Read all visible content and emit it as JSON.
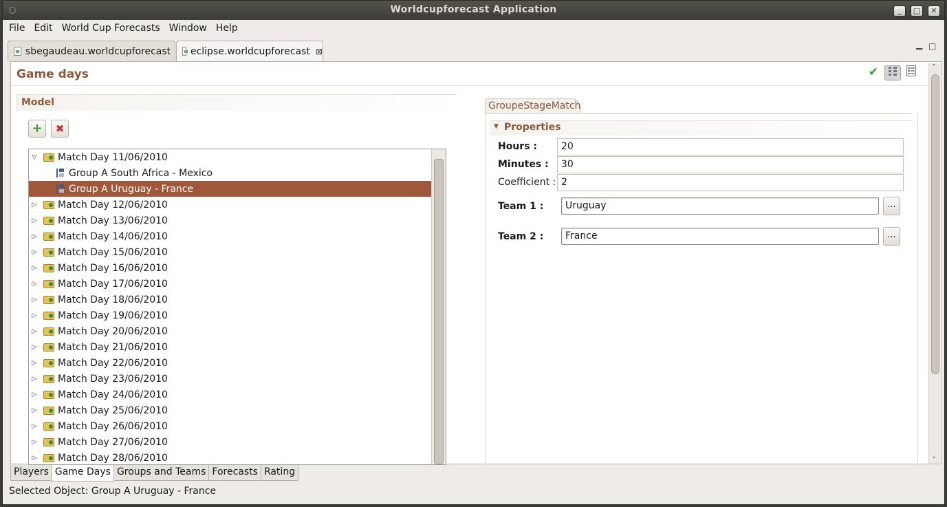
{
  "window": {
    "title": "Worldcupforecast Application",
    "minimize": "_",
    "maximize": "□",
    "close": "✕"
  },
  "menu": [
    {
      "label": "File"
    },
    {
      "label": "Edit"
    },
    {
      "label": "World Cup Forecasts"
    },
    {
      "label": "Window"
    },
    {
      "label": "Help"
    }
  ],
  "editor_tabs": [
    {
      "label": "sbegaudeau.worldcupforecast",
      "active": false
    },
    {
      "label": "eclipse.worldcupforecast",
      "active": true,
      "close": "⊠"
    }
  ],
  "form": {
    "title": "Game days"
  },
  "model": {
    "section_label": "Model",
    "add_symbol": "+",
    "delete_symbol": "✖",
    "tree": [
      {
        "label": "Match Day 11/06/2010",
        "type": "day",
        "expanded": true
      },
      {
        "label": "Group A South Africa - Mexico",
        "type": "match"
      },
      {
        "label": "Group A Uruguay - France",
        "type": "match",
        "selected": true
      },
      {
        "label": "Match Day 12/06/2010",
        "type": "day"
      },
      {
        "label": "Match Day 13/06/2010",
        "type": "day"
      },
      {
        "label": "Match Day 14/06/2010",
        "type": "day"
      },
      {
        "label": "Match Day 15/06/2010",
        "type": "day"
      },
      {
        "label": "Match Day 16/06/2010",
        "type": "day"
      },
      {
        "label": "Match Day 17/06/2010",
        "type": "day"
      },
      {
        "label": "Match Day 18/06/2010",
        "type": "day"
      },
      {
        "label": "Match Day 19/06/2010",
        "type": "day"
      },
      {
        "label": "Match Day 20/06/2010",
        "type": "day"
      },
      {
        "label": "Match Day 21/06/2010",
        "type": "day"
      },
      {
        "label": "Match Day 22/06/2010",
        "type": "day"
      },
      {
        "label": "Match Day 23/06/2010",
        "type": "day"
      },
      {
        "label": "Match Day 24/06/2010",
        "type": "day"
      },
      {
        "label": "Match Day 25/06/2010",
        "type": "day"
      },
      {
        "label": "Match Day 26/06/2010",
        "type": "day"
      },
      {
        "label": "Match Day 27/06/2010",
        "type": "day"
      },
      {
        "label": "Match Day 28/06/2010",
        "type": "day"
      }
    ]
  },
  "properties": {
    "tab_label": "GroupeStageMatch",
    "section_label": "Properties",
    "hours_label": "Hours :",
    "hours_value": "20",
    "minutes_label": "Minutes :",
    "minutes_value": "30",
    "coefficient_label": "Coefficient :",
    "coefficient_value": "2",
    "team1_label": "Team 1 :",
    "team1_value": "Uruguay",
    "team2_label": "Team 2 :",
    "team2_value": "France",
    "browse_label": "..."
  },
  "bottom_tabs": [
    {
      "label": "Players",
      "active": false
    },
    {
      "label": "Game Days",
      "active": true
    },
    {
      "label": "Groups and Teams",
      "active": false
    },
    {
      "label": "Forecasts",
      "active": false
    },
    {
      "label": "Rating",
      "active": false
    }
  ],
  "status": {
    "text": "Selected Object: Group A Uruguay - France"
  },
  "colors": {
    "accent": "#8b5a3c",
    "selection": "#a0573a",
    "titlebar": "#3c3b37"
  }
}
